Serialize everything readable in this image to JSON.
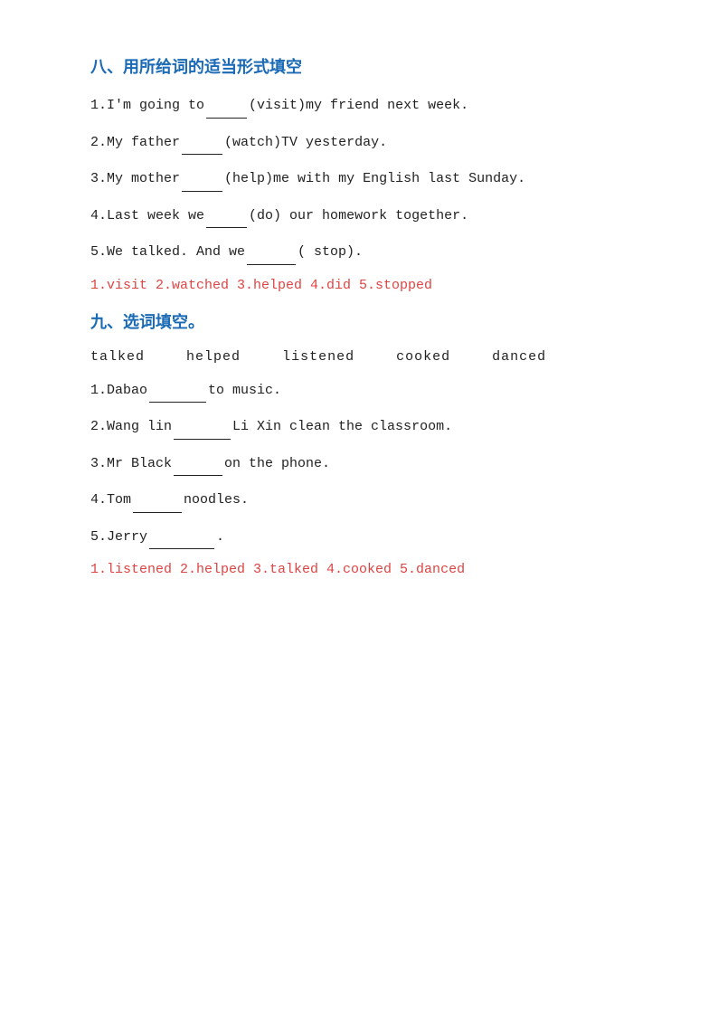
{
  "section8": {
    "title": "八、用所给词的适当形式填空",
    "questions": [
      "1.I'm going to_____(visit)my friend next week.",
      "2.My father_____(watch)TV yesterday.",
      "3.My mother_____(help)me with my English last Sunday.",
      "4.Last week we_____(do) our homework together.",
      "5.We talked. And we______( stop)."
    ],
    "answers": "1.visit   2.watched   3.helped   4.did   5.stopped"
  },
  "section9": {
    "title": "九、选词填空。",
    "wordBank": [
      "talked",
      "helped",
      "listened",
      "cooked",
      "danced"
    ],
    "questions": [
      "1.Dabao_______to music.",
      "2.Wang lin_______Li Xin clean the classroom.",
      "3.Mr Black______on the phone.",
      "4.Tom______noodles.",
      "5.Jerry________."
    ],
    "answers": "1.listened 2.helped 3.talked 4.cooked 5.danced"
  }
}
